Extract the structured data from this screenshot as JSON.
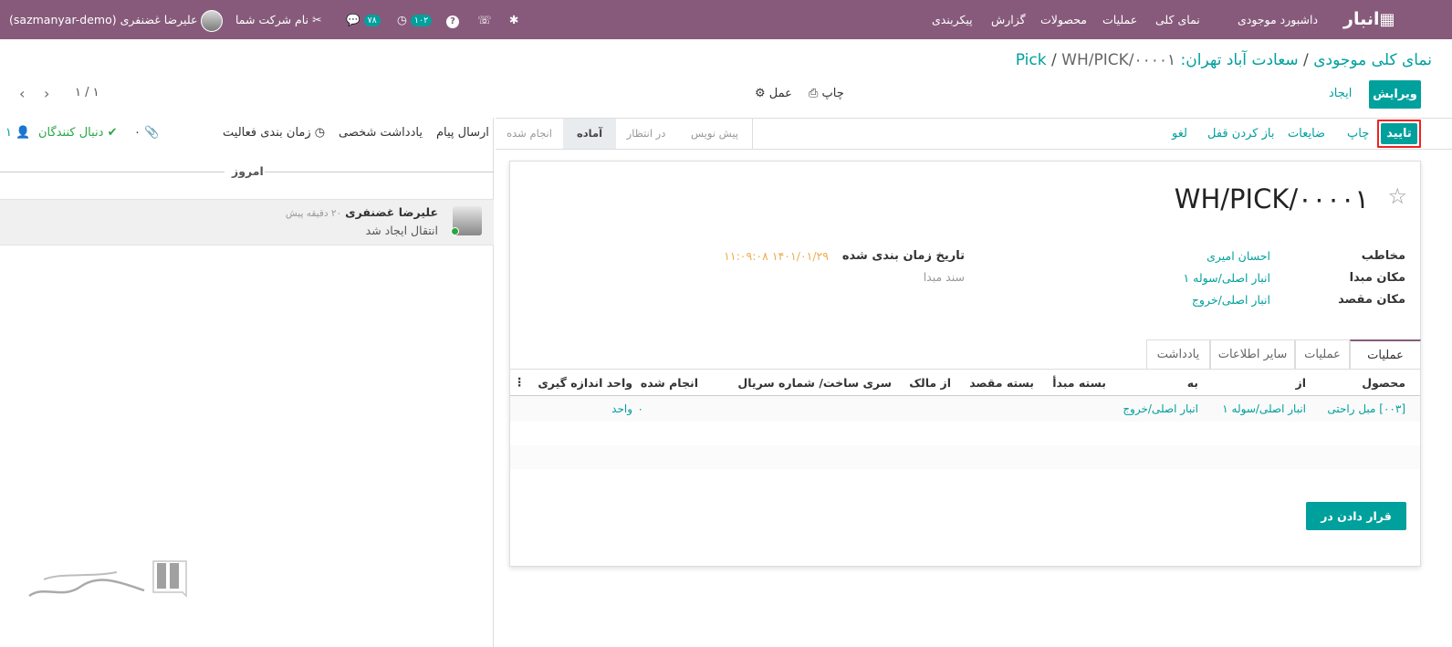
{
  "topbar": {
    "app_name": "انبار",
    "menu": [
      "داشبورد موجودی",
      "نمای کلی",
      "عملیات",
      "محصولات",
      "گزارش",
      "پیکربندی"
    ],
    "company": "نام شرکت شما",
    "user": "علیرضا غضنفری (sazmanyar-demo)",
    "activity_count": "۱۰۲",
    "message_count": "۷۸"
  },
  "breadcrumb": {
    "first": "نمای کلی موجودی",
    "sep": "/",
    "second": "سعادت آباد تهران: Pick",
    "current": "WH/PICK/۰۰۰۰۱"
  },
  "controls": {
    "edit": "ویرایش",
    "create": "ایجاد",
    "print": "چاپ",
    "action": "عمل",
    "pager": "۱ / ۱"
  },
  "status_buttons": [
    "تایید",
    "چاپ",
    "ضایعات",
    "باز کردن قفل",
    "لغو"
  ],
  "stages": [
    "پیش نویس",
    "در انتظار",
    "آماده",
    "انجام شده"
  ],
  "active_stage": "آماده",
  "form": {
    "title": "WH/PICK/۰۰۰۰۱",
    "partner_label": "مخاطب",
    "partner": "احسان امیری",
    "src_label": "مکان مبدا",
    "src": "انبار اصلی/سوله ۱",
    "dest_label": "مکان مقصد",
    "dest": "انبار اصلی/خروج",
    "sched_label": "تاریخ زمان بندی شده",
    "sched": "۱۴۰۱/۰۱/۲۹ ۱۱:۰۹:۰۸",
    "origin_placeholder": "سند مبدا"
  },
  "tabs": [
    "عملیات",
    "عملیات",
    "سایر اطلاعات",
    "یادداشت"
  ],
  "table": {
    "headers": [
      "محصول",
      "از",
      "به",
      "بسته مبدأ",
      "بسته مقصد",
      "از مالک",
      "سری ساخت/ شماره سریال",
      "انجام شده",
      "واحد اندازه گیری"
    ],
    "row": {
      "product": "[۰۰۳] مبل راحتی",
      "from": "انبار اصلی/سوله ۱",
      "to": "انبار اصلی/خروج",
      "done": "۰",
      "uom": "واحد"
    }
  },
  "pack_button": "قرار دادن در بسته",
  "chatter": {
    "send_message": "ارسال پیام",
    "log_note": "یادداشت شخصی",
    "schedule": "زمان بندی فعالیت",
    "attachments": "۰",
    "follow": "دنبال کنندگان",
    "followers": "۱",
    "today": "امروز",
    "author": "علیرضا غضنفری",
    "time": "۲۰ دقیقه پیش",
    "body": "انتقال ایجاد شد"
  },
  "colors": {
    "brand": "#875a7b",
    "accent": "#00a09d",
    "warn": "#f0ad4e"
  }
}
